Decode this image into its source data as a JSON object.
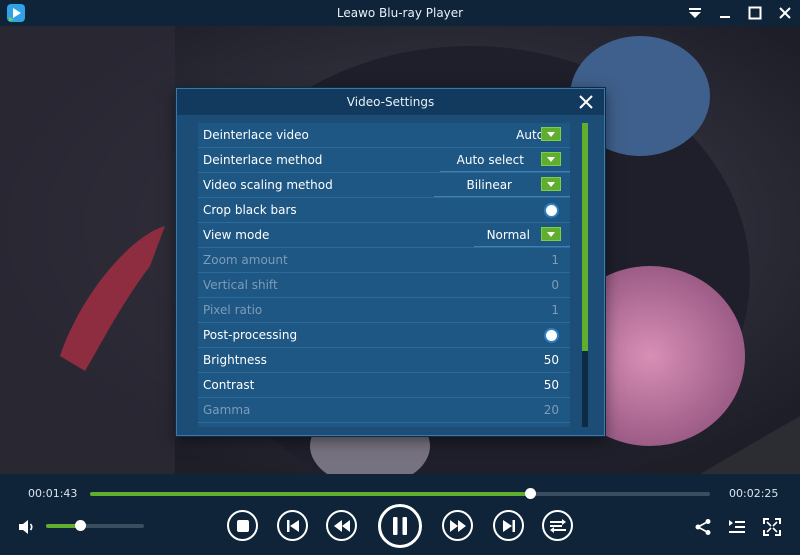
{
  "window": {
    "title": "Leawo Blu-ray Player"
  },
  "dialog": {
    "title": "Video-Settings",
    "rows": [
      {
        "label": "Deinterlace video",
        "value": "Auto",
        "kind": "dropdown",
        "enabled": true
      },
      {
        "label": "Deinterlace method",
        "value": "Auto select",
        "kind": "dropdown",
        "enabled": true
      },
      {
        "label": "Video scaling method",
        "value": "Bilinear",
        "kind": "dropdown",
        "enabled": true
      },
      {
        "label": "Crop black bars",
        "value": "",
        "kind": "toggle",
        "enabled": true
      },
      {
        "label": "View mode",
        "value": "Normal",
        "kind": "dropdown",
        "enabled": true
      },
      {
        "label": "Zoom amount",
        "value": "1",
        "kind": "number",
        "enabled": false
      },
      {
        "label": "Vertical shift",
        "value": "0",
        "kind": "number",
        "enabled": false
      },
      {
        "label": "Pixel ratio",
        "value": "1",
        "kind": "number",
        "enabled": false
      },
      {
        "label": "Post-processing",
        "value": "",
        "kind": "toggle",
        "enabled": true
      },
      {
        "label": "Brightness",
        "value": "50",
        "kind": "number",
        "enabled": true
      },
      {
        "label": "Contrast",
        "value": "50",
        "kind": "number",
        "enabled": true
      },
      {
        "label": "Gamma",
        "value": "20",
        "kind": "number",
        "enabled": false
      }
    ]
  },
  "playback": {
    "elapsed": "00:01:43",
    "total": "00:02:25",
    "progress_fraction": 0.71,
    "volume_fraction": 0.35
  },
  "colors": {
    "accent": "#5fae2e",
    "titlebar": "#0f2438",
    "dialog": "#1b4d77"
  },
  "icons": {
    "app": "leawo-play-icon",
    "window": [
      "menu-dropdown-icon",
      "minimize-icon",
      "maximize-icon",
      "close-icon"
    ],
    "controls": [
      "stop-icon",
      "previous-icon",
      "rewind-icon",
      "pause-icon",
      "fast-forward-icon",
      "next-icon",
      "playlist-repeat-icon"
    ],
    "right": [
      "share-icon",
      "playlist-icon",
      "fullscreen-icon"
    ]
  }
}
